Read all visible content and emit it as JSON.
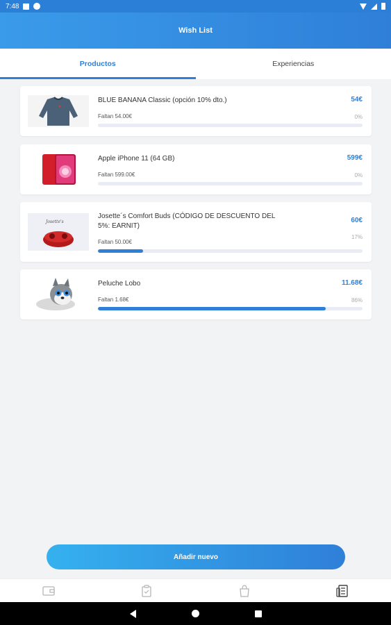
{
  "status_bar": {
    "time": "7:48"
  },
  "header": {
    "title": "Wish List"
  },
  "tabs": [
    {
      "label": "Productos",
      "active": true
    },
    {
      "label": "Experiencias",
      "active": false
    }
  ],
  "products": [
    {
      "name": "BLUE BANANA Classic (opción 10% dto.)",
      "price": "54€",
      "missing": "Faltan 54.00€",
      "percent_label": "0%",
      "progress": 0,
      "image": "sweater-image"
    },
    {
      "name": "Apple iPhone 11 (64 GB)",
      "price": "599€",
      "missing": "Faltan 599.00€",
      "percent_label": "0%",
      "progress": 0,
      "image": "iphone-image"
    },
    {
      "name": "Josette´s Comfort Buds (CÓDIGO DE DESCUENTO DEL 5%: EARNIT)",
      "price": "60€",
      "missing": "Faltan 50.00€",
      "percent_label": "17%",
      "progress": 0.17,
      "image": "earbuds-image"
    },
    {
      "name": "Peluche Lobo",
      "price": "11.68€",
      "missing": "Faltan 1.68€",
      "percent_label": "86%",
      "progress": 0.86,
      "image": "plush-wolf-image"
    }
  ],
  "add_button": {
    "label": "Añadir nuevo"
  },
  "bottom_nav": [
    {
      "icon": "wallet-icon",
      "active": false
    },
    {
      "icon": "clipboard-icon",
      "active": false
    },
    {
      "icon": "shopping-bag-icon",
      "active": false
    },
    {
      "icon": "receipt-list-icon",
      "active": true
    }
  ],
  "colors": {
    "accent": "#2f7fd8",
    "header_start": "#3a9bea",
    "track": "#e9ecf5",
    "background": "#f2f3f5"
  }
}
